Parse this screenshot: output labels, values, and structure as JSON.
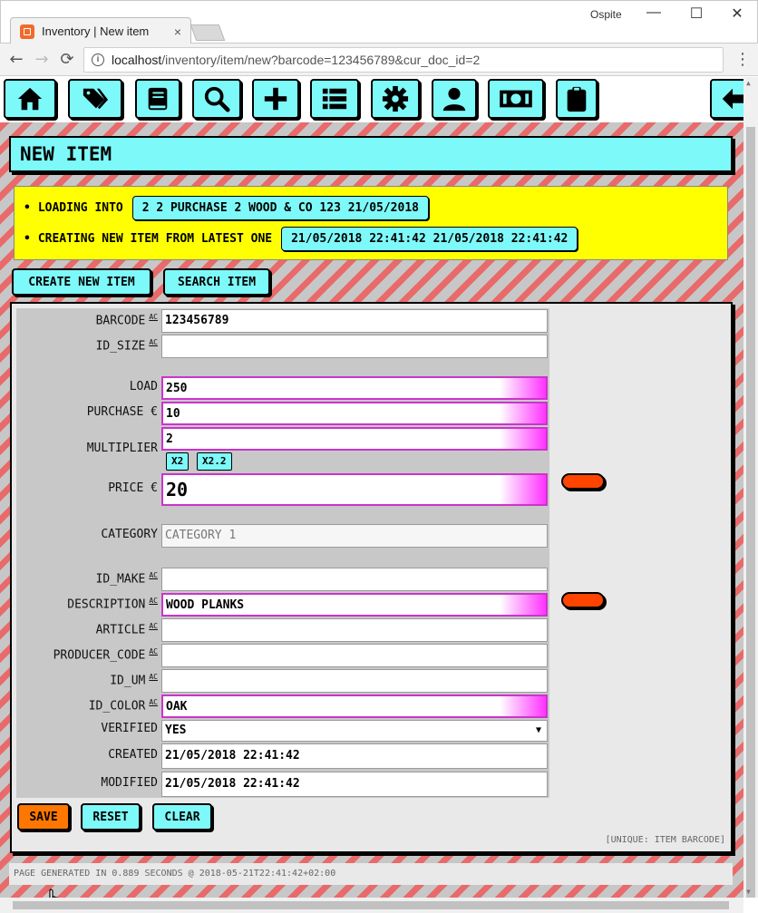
{
  "browser": {
    "tab_title": "Inventory | New item",
    "tab_close": "×",
    "user": "Ospite",
    "minimize": "—",
    "maximize": "☐",
    "close": "✕",
    "back": "←",
    "forward": "→",
    "reload": "⟳",
    "url_host": "localhost",
    "url_path": "/inventory/item/new?barcode=123456789&cur_doc_id=2",
    "menu": "⋮"
  },
  "toolbar": {
    "buttons": [
      "home-icon",
      "tags-icon",
      "book-icon",
      "search-icon",
      "plus-icon",
      "list-icon",
      "gear-icon",
      "user-icon",
      "money-icon",
      "clipboard-icon",
      "arrow-left-icon"
    ],
    "accent": "#7ef9f9"
  },
  "page": {
    "title": "NEW ITEM",
    "loading_label": "LOADING INTO",
    "loading_value": "2 2 PURCHASE 2 WOOD & CO 123 21/05/2018",
    "creating_label": "CREATING NEW ITEM FROM LATEST ONE",
    "creating_value": "21/05/2018 22:41:42 21/05/2018 22:41:42",
    "bullet": "•",
    "create_new_button": "CREATE NEW ITEM",
    "search_button": "SEARCH ITEM"
  },
  "form": {
    "ac": "AC",
    "barcode_label": "BARCODE",
    "barcode_value": "123456789",
    "id_size_label": "ID_SIZE",
    "id_size_value": "",
    "load_label": "LOAD",
    "load_value": "250",
    "purchase_label": "PURCHASE €",
    "purchase_value": "10",
    "multiplier_label": "MULTIPLIER",
    "multiplier_value": "2",
    "x2_button": "X2",
    "x22_button": "X2.2",
    "price_label": "PRICE €",
    "price_value": "20",
    "category_label": "CATEGORY",
    "category_placeholder": "CATEGORY 1",
    "id_make_label": "ID_MAKE",
    "id_make_value": "",
    "description_label": "DESCRIPTION",
    "description_value": "WOOD PLANKS",
    "article_label": "ARTICLE",
    "article_value": "",
    "producer_code_label": "PRODUCER_CODE",
    "producer_code_value": "",
    "id_um_label": "ID_UM",
    "id_um_value": "",
    "id_color_label": "ID_COLOR",
    "id_color_value": "OAK",
    "verified_label": "VERIFIED",
    "verified_value": "YES",
    "verified_caret": "▼",
    "created_label": "CREATED",
    "created_value": "21/05/2018  22:41:42",
    "modified_label": "MODIFIED",
    "modified_value": "21/05/2018  22:41:42",
    "save_button": "SAVE",
    "reset_button": "RESET",
    "clear_button": "CLEAR",
    "unique_note": "[UNIQUE: ITEM BARCODE]",
    "highlight_color": "#cc33cc",
    "pill_color": "#ff4400",
    "save_color": "#ff7700"
  },
  "footer": {
    "generated": "PAGE GENERATED IN 0.889 SECONDS @ 2018-05-21T22:41:42+02:00"
  }
}
